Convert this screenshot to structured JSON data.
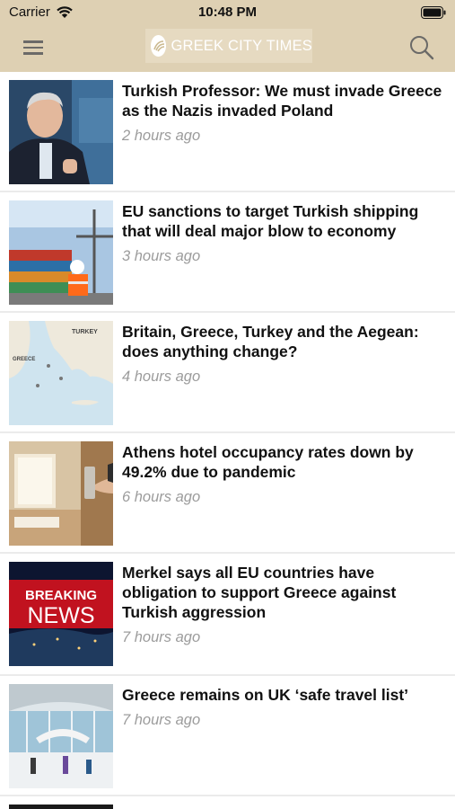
{
  "status_bar": {
    "carrier": "Carrier",
    "time": "10:48 PM"
  },
  "header": {
    "logo_text": "GREEK CITY TIMES",
    "menu_icon": "hamburger-menu-icon",
    "search_icon": "search-icon",
    "background_color": "#ded0b3"
  },
  "articles": [
    {
      "title": "Turkish Professor: We must invade Greece as the Nazis invaded Poland",
      "time_ago": "2 hours ago",
      "thumb": "professor-tv-studio"
    },
    {
      "title": "EU sanctions to target Turkish shipping that will deal major blow to economy",
      "time_ago": "3 hours ago",
      "thumb": "shipping-containers-port"
    },
    {
      "title": "Britain, Greece, Turkey and the Aegean: does anything change?",
      "time_ago": "4 hours ago",
      "thumb": "aegean-map",
      "thumb_labels": {
        "turkey": "TURKEY",
        "greece": "GREECE"
      }
    },
    {
      "title": "Athens hotel occupancy rates down by 49.2% due to pandemic",
      "time_ago": "6 hours ago",
      "thumb": "hotel-room-door"
    },
    {
      "title": "Merkel says all EU countries have obligation to support Greece against Turkish aggression",
      "time_ago": "7 hours ago",
      "thumb": "breaking-news",
      "thumb_labels": {
        "line1": "BREAKING",
        "line2": "NEWS"
      }
    },
    {
      "title": "Greece remains on UK ‘safe travel list’",
      "time_ago": "7 hours ago",
      "thumb": "airport-terminal"
    }
  ]
}
